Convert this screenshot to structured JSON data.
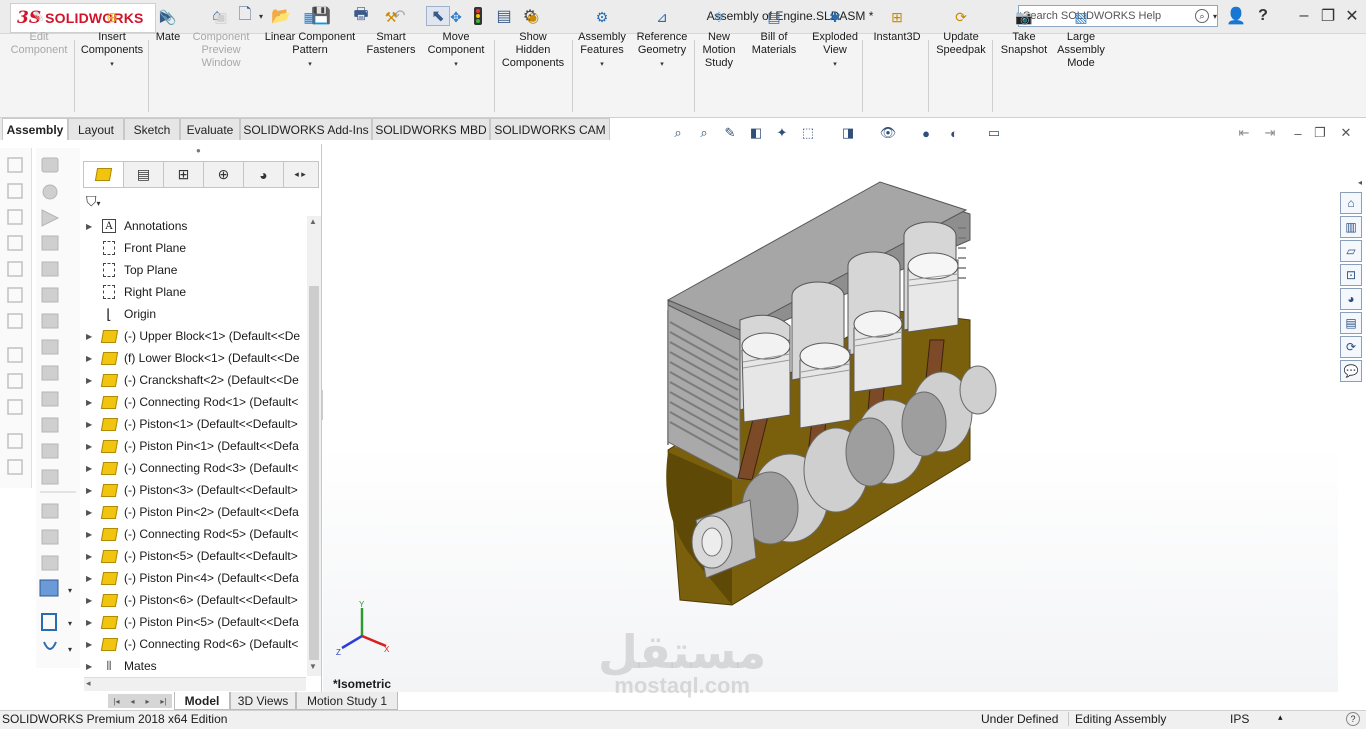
{
  "app": {
    "logo_ds": "3S",
    "logo_name": "SOLIDWORKS",
    "window_title": "Assembly of Engine.SLDASM *",
    "search_placeholder": "Search SOLIDWORKS Help"
  },
  "commands": [
    {
      "label": "Edit\nComponent",
      "icon": "edit-component-icon",
      "enabled": false
    },
    {
      "label": "Insert\nComponents",
      "icon": "insert-components-icon",
      "enabled": true
    },
    {
      "label": "Mate",
      "icon": "mate-icon",
      "enabled": true
    },
    {
      "label": "Component\nPreview\nWindow",
      "icon": "preview-window-icon",
      "enabled": false
    },
    {
      "label": "Linear Component\nPattern",
      "icon": "linear-pattern-icon",
      "enabled": true
    },
    {
      "label": "Smart\nFasteners",
      "icon": "smart-fasteners-icon",
      "enabled": true
    },
    {
      "label": "Move\nComponent",
      "icon": "move-component-icon",
      "enabled": true
    },
    {
      "label": "Show\nHidden\nComponents",
      "icon": "show-hidden-icon",
      "enabled": true
    },
    {
      "label": "Assembly\nFeatures",
      "icon": "assembly-features-icon",
      "enabled": true
    },
    {
      "label": "Reference\nGeometry",
      "icon": "reference-geometry-icon",
      "enabled": true
    },
    {
      "label": "New\nMotion\nStudy",
      "icon": "motion-study-icon",
      "enabled": true
    },
    {
      "label": "Bill of\nMaterials",
      "icon": "bom-icon",
      "enabled": true
    },
    {
      "label": "Exploded\nView",
      "icon": "exploded-view-icon",
      "enabled": true
    },
    {
      "label": "Instant3D",
      "icon": "instant3d-icon",
      "enabled": true
    },
    {
      "label": "Update\nSpeedpak",
      "icon": "speedpak-icon",
      "enabled": true
    },
    {
      "label": "Take\nSnapshot",
      "icon": "camera-icon",
      "enabled": true
    },
    {
      "label": "Large\nAssembly\nMode",
      "icon": "large-assembly-icon",
      "enabled": true
    }
  ],
  "tabs": [
    "Assembly",
    "Layout",
    "Sketch",
    "Evaluate",
    "SOLIDWORKS Add-Ins",
    "SOLIDWORKS MBD",
    "SOLIDWORKS CAM"
  ],
  "tree": [
    {
      "label": "Annotations",
      "type": "annotations",
      "expandable": true
    },
    {
      "label": "Front Plane",
      "type": "plane",
      "expandable": false
    },
    {
      "label": "Top Plane",
      "type": "plane",
      "expandable": false
    },
    {
      "label": "Right Plane",
      "type": "plane",
      "expandable": false
    },
    {
      "label": "Origin",
      "type": "origin",
      "expandable": false
    },
    {
      "label": "(-) Upper Block<1> (Default<<De",
      "type": "part",
      "expandable": true
    },
    {
      "label": "(f) Lower Block<1> (Default<<De",
      "type": "part",
      "expandable": true
    },
    {
      "label": "(-) Cranckshaft<2> (Default<<De",
      "type": "part",
      "expandable": true
    },
    {
      "label": "(-) Connecting Rod<1> (Default<",
      "type": "part",
      "expandable": true
    },
    {
      "label": "(-) Piston<1> (Default<<Default>",
      "type": "part",
      "expandable": true
    },
    {
      "label": "(-) Piston Pin<1> (Default<<Defa",
      "type": "part",
      "expandable": true
    },
    {
      "label": "(-) Connecting Rod<3> (Default<",
      "type": "part",
      "expandable": true
    },
    {
      "label": "(-) Piston<3> (Default<<Default>",
      "type": "part",
      "expandable": true
    },
    {
      "label": "(-) Piston Pin<2> (Default<<Defa",
      "type": "part",
      "expandable": true
    },
    {
      "label": "(-) Connecting Rod<5> (Default<",
      "type": "part",
      "expandable": true
    },
    {
      "label": "(-) Piston<5> (Default<<Default>",
      "type": "part",
      "expandable": true
    },
    {
      "label": "(-) Piston Pin<4> (Default<<Defa",
      "type": "part",
      "expandable": true
    },
    {
      "label": "(-) Piston<6> (Default<<Default>",
      "type": "part",
      "expandable": true
    },
    {
      "label": "(-) Piston Pin<5> (Default<<Defa",
      "type": "part",
      "expandable": true
    },
    {
      "label": "(-) Connecting Rod<6> (Default<",
      "type": "part",
      "expandable": true
    },
    {
      "label": "Mates",
      "type": "mates",
      "expandable": true
    }
  ],
  "viewport": {
    "view_name": "*Isometric",
    "triad_labels": {
      "x": "X",
      "y": "Y",
      "z": "Z"
    }
  },
  "bottom_tabs": [
    "Model",
    "3D Views",
    "Motion Study 1"
  ],
  "status": {
    "edition": "SOLIDWORKS Premium 2018 x64 Edition",
    "definition": "Under Defined",
    "mode": "Editing Assembly",
    "units": "IPS"
  },
  "watermark": {
    "arabic": "مستقل",
    "latin": "mostaql.com"
  },
  "colors": {
    "brand": "#d2142b",
    "part": "#f1c40f",
    "block_interior": "#8a6d10"
  }
}
